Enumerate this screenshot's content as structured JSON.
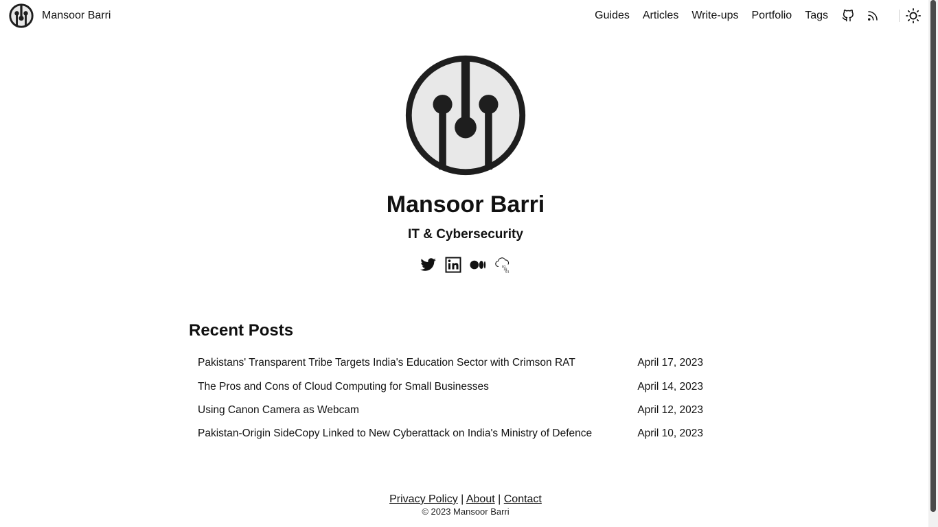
{
  "site": {
    "brand_name": "Mansoor Barri"
  },
  "nav": {
    "links": [
      "Guides",
      "Articles",
      "Write-ups",
      "Portfolio",
      "Tags"
    ],
    "icons": [
      "github-icon",
      "rss-icon",
      "sun-icon"
    ]
  },
  "profile": {
    "name": "Mansoor Barri",
    "subtitle": "IT & Cybersecurity",
    "social": [
      "twitter-icon",
      "linkedin-icon",
      "medium-icon",
      "cloud-binary-icon"
    ]
  },
  "recent_posts": {
    "title": "Recent Posts",
    "items": [
      {
        "title": "Pakistans' Transparent Tribe Targets India's Education Sector with Crimson RAT",
        "date": "April 17, 2023"
      },
      {
        "title": "The Pros and Cons of Cloud Computing for Small Businesses",
        "date": "April 14, 2023"
      },
      {
        "title": "Using Canon Camera as Webcam",
        "date": "April 12, 2023"
      },
      {
        "title": "Pakistan-Origin SideCopy Linked to New Cyberattack on India's Ministry of Defence",
        "date": "April 10, 2023"
      }
    ]
  },
  "footer": {
    "privacy": "Privacy Policy",
    "about": "About",
    "contact": "Contact",
    "separator": "|",
    "copyright": "© 2023 Mansoor Barri"
  },
  "colors": {
    "text": "#111111",
    "background": "#ffffff",
    "logo_fill": "#e8e8e8",
    "logo_stroke": "#1e1e1e"
  }
}
